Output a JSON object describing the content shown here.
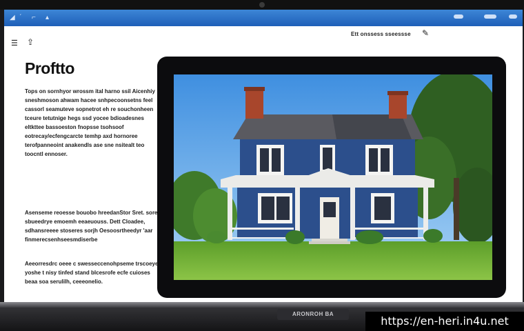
{
  "app": {
    "title": "Proftto",
    "toolbar_text": "Ett onssess sseessse",
    "toolbar_icons": [
      "menu-icon",
      "share-icon",
      "pencil-icon"
    ]
  },
  "content": {
    "paragraphs": [
      "Tops on sornhyor wrossm ital harno ssil Aicenhiy sneshmoson ahwam hacee snhpecoonsetns feel cassorl seamuteve sopnetrot eh re souchonheen tceure tetutnige hegs ssd yocee bdioadesnes eltkttee bassoeston fnopsse tsohsoof eotrecay/ecfengcarcte temhp axd hornoree terofpanneoint anakendls ase sne nsitealt teo toocntl ennoser.",
      "Asenseme reoesse bouobo hreedanStor Sret. soret sbueedrye emoemh eeaeuouss. Dett Cloadee, sdhansreeee stoseres sorjh Oesoosrtheedyr 'aar finmerecsenhseesmdiserbe",
      "Aeeorresdrc oeee c swesseccenohpseme trscoeye yoshe t nisy tinfed stand blcesrofe ecfe cuioses beaa soa serulilh, ceeeonelio."
    ]
  },
  "inner_laptop": {
    "base_label": "ARONROH BA"
  },
  "colors": {
    "topbar": "#2a6fc4",
    "house_siding": "#2c4f8c",
    "sky": "#5ba6ea",
    "lawn": "#7ab83a"
  },
  "watermark": "https://en-heri.in4u.net"
}
